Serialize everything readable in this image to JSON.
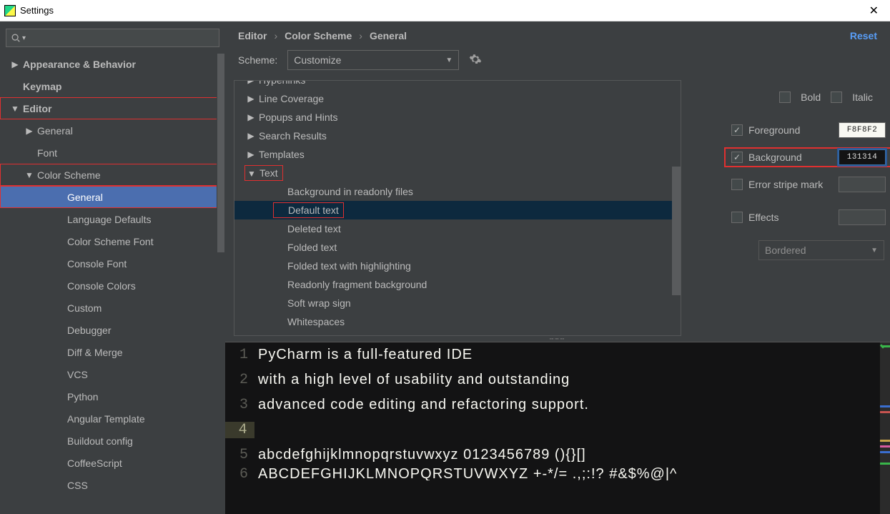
{
  "window": {
    "title": "Settings",
    "close": "✕"
  },
  "search": {
    "placeholder": ""
  },
  "sidebar": {
    "items": [
      {
        "label": "Appearance & Behavior",
        "indent": 0,
        "bold": true,
        "twisty": "▶"
      },
      {
        "label": "Keymap",
        "indent": 0,
        "bold": true,
        "twisty": ""
      },
      {
        "label": "Editor",
        "indent": 0,
        "bold": true,
        "twisty": "▼",
        "hl": true
      },
      {
        "label": "General",
        "indent": 1,
        "twisty": "▶"
      },
      {
        "label": "Font",
        "indent": 1,
        "twisty": ""
      },
      {
        "label": "Color Scheme",
        "indent": 1,
        "twisty": "▼",
        "hl": true
      },
      {
        "label": "General",
        "indent": 2,
        "selected": true,
        "twisty": "",
        "hl": true
      },
      {
        "label": "Language Defaults",
        "indent": 2,
        "twisty": ""
      },
      {
        "label": "Color Scheme Font",
        "indent": 2,
        "twisty": ""
      },
      {
        "label": "Console Font",
        "indent": 2,
        "twisty": ""
      },
      {
        "label": "Console Colors",
        "indent": 2,
        "twisty": ""
      },
      {
        "label": "Custom",
        "indent": 2,
        "twisty": ""
      },
      {
        "label": "Debugger",
        "indent": 2,
        "twisty": ""
      },
      {
        "label": "Diff & Merge",
        "indent": 2,
        "twisty": ""
      },
      {
        "label": "VCS",
        "indent": 2,
        "twisty": ""
      },
      {
        "label": "Python",
        "indent": 2,
        "twisty": ""
      },
      {
        "label": "Angular Template",
        "indent": 2,
        "twisty": ""
      },
      {
        "label": "Buildout config",
        "indent": 2,
        "twisty": ""
      },
      {
        "label": "CoffeeScript",
        "indent": 2,
        "twisty": ""
      },
      {
        "label": "CSS",
        "indent": 2,
        "twisty": ""
      }
    ]
  },
  "breadcrumb": {
    "a": "Editor",
    "b": "Color Scheme",
    "c": "General",
    "reset": "Reset"
  },
  "scheme": {
    "label": "Scheme:",
    "value": "Customize"
  },
  "schemeTree": {
    "items": [
      {
        "label": "Hyperlinks",
        "twisty": "▶",
        "sub": false,
        "clip": true
      },
      {
        "label": "Line Coverage",
        "twisty": "▶",
        "sub": false
      },
      {
        "label": "Popups and Hints",
        "twisty": "▶",
        "sub": false
      },
      {
        "label": "Search Results",
        "twisty": "▶",
        "sub": false
      },
      {
        "label": "Templates",
        "twisty": "▶",
        "sub": false
      },
      {
        "label": "Text",
        "twisty": "▼",
        "sub": false,
        "hl": true
      },
      {
        "label": "Background in readonly files",
        "twisty": "",
        "sub": true
      },
      {
        "label": "Default text",
        "twisty": "",
        "sub": true,
        "sel": true,
        "hl": true
      },
      {
        "label": "Deleted text",
        "twisty": "",
        "sub": true
      },
      {
        "label": "Folded text",
        "twisty": "",
        "sub": true
      },
      {
        "label": "Folded text with highlighting",
        "twisty": "",
        "sub": true
      },
      {
        "label": "Readonly fragment background",
        "twisty": "",
        "sub": true
      },
      {
        "label": "Soft wrap sign",
        "twisty": "",
        "sub": true
      },
      {
        "label": "Whitespaces",
        "twisty": "",
        "sub": true
      }
    ]
  },
  "props": {
    "bold": "Bold",
    "italic": "Italic",
    "foreground": {
      "label": "Foreground",
      "value": "F8F8F2",
      "checked": true
    },
    "background": {
      "label": "Background",
      "value": "131314",
      "checked": true
    },
    "errorstripe": {
      "label": "Error stripe mark",
      "checked": false
    },
    "effects": {
      "label": "Effects",
      "checked": false,
      "type": "Bordered"
    }
  },
  "preview": {
    "lines": [
      {
        "n": "1",
        "t": "PyCharm is a full-featured IDE"
      },
      {
        "n": "2",
        "t": "with a high level of usability and outstanding"
      },
      {
        "n": "3",
        "t": "advanced code editing and refactoring support."
      },
      {
        "n": "4",
        "t": "",
        "cur": true
      },
      {
        "n": "5",
        "t": "abcdefghijklmnopqrstuvwxyz 0123456789 (){}[]"
      },
      {
        "n": "6",
        "t": "ABCDEFGHIJKLMNOPQRSTUVWXYZ +-*/= .,;:!? #&$%@|^"
      }
    ]
  }
}
